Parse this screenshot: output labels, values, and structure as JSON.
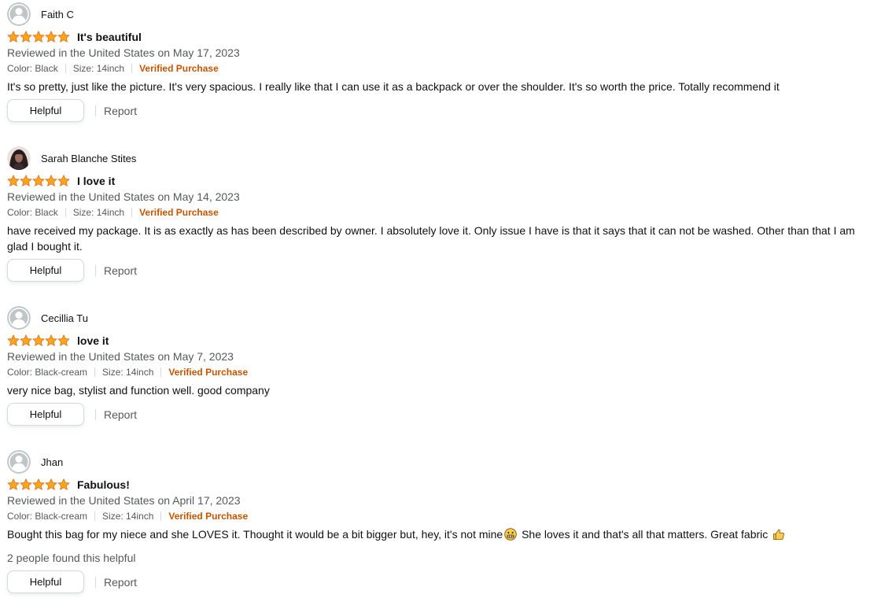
{
  "colors": {
    "star": "#ffa41c",
    "verified": "#c45500",
    "muted_text": "#565959",
    "avatar_bg": "#c0c6c6"
  },
  "reviews": [
    {
      "profile_name": "Faith C",
      "avatar": "default-avatar-icon",
      "rating": 5,
      "title": "It's beautiful",
      "date": "Reviewed in the United States on May 17, 2023",
      "color": "Color: Black",
      "size": "Size: 14inch",
      "verified": "Verified Purchase",
      "body": "It's so pretty, just like the picture. It's very spacious. I really like that I can use it as a backpack or over the shoulder. It's so worth the price. Totally recommend it",
      "helpful_label": "Helpful",
      "report_label": "Report"
    },
    {
      "profile_name": "Sarah Blanche Stites",
      "avatar": "user-photo-avatar",
      "rating": 5,
      "title": "I love it",
      "date": "Reviewed in the United States on May 14, 2023",
      "color": "Color: Black",
      "size": "Size: 14inch",
      "verified": "Verified Purchase",
      "body": "have received my package. It is as exactly as has been described by owner. I absolutely love it. Only issue I have is that it says that it can not be washed. Other than that I am glad I bought it.",
      "helpful_label": "Helpful",
      "report_label": "Report"
    },
    {
      "profile_name": "Cecillia Tu",
      "avatar": "default-avatar-icon",
      "rating": 5,
      "title": "love it",
      "date": "Reviewed in the United States on May 7, 2023",
      "color": "Color: Black-cream",
      "size": "Size: 14inch",
      "verified": "Verified Purchase",
      "body": "very nice bag, stylist and function well. good company",
      "helpful_label": "Helpful",
      "report_label": "Report"
    },
    {
      "profile_name": "Jhan",
      "avatar": "default-avatar-icon",
      "rating": 5,
      "title": "Fabulous!",
      "date": "Reviewed in the United States on April 17, 2023",
      "color": "Color: Black-cream",
      "size": "Size: 14inch",
      "verified": "Verified Purchase",
      "body_part1": "Bought this bag for my niece and she LOVES it. Thought it would be a bit bigger but, hey, it's not mine",
      "body_part2": "She loves it and that's all that matters. Great fabric",
      "emoji1": "grimacing-face-icon",
      "emoji2": "thumbs-up-icon",
      "helpful_count": "2 people found this helpful",
      "helpful_label": "Helpful",
      "report_label": "Report"
    }
  ]
}
